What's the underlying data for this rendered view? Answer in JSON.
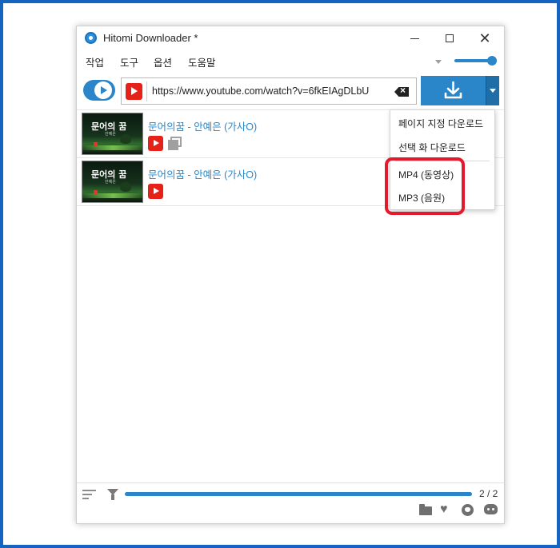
{
  "window": {
    "title": "Hitomi Downloader *"
  },
  "menubar": {
    "items": [
      "작업",
      "도구",
      "옵션",
      "도움말"
    ]
  },
  "url_bar": {
    "value": "https://www.youtube.com/watch?v=6fkEIAgDLbU",
    "site_icon": "youtube-icon"
  },
  "download_menu": {
    "items": [
      "페이지 지정 다운로드",
      "선택 화 다운로드",
      "MP4 (동영상)",
      "MP3 (음원)"
    ],
    "highlight_color": "#e3192d"
  },
  "list": {
    "items": [
      {
        "title": "문어의꿈 - 안예은 (가사O)",
        "thumb_text": "문어의 꿈",
        "thumb_sub": "안예은",
        "source_icon": "youtube-icon",
        "has_playlist_icon": true
      },
      {
        "title": "문어의꿈 - 안예은 (가사O)",
        "thumb_text": "문어의 꿈",
        "thumb_sub": "안예은",
        "source_icon": "youtube-icon",
        "has_playlist_icon": false
      }
    ]
  },
  "status": {
    "progress_text": "2 / 2",
    "progress_fraction": 1.0
  },
  "colors": {
    "accent": "#2a86c9",
    "frame": "#1565c0",
    "youtube": "#e62117"
  },
  "volume": {
    "level_fraction": 0.9
  }
}
